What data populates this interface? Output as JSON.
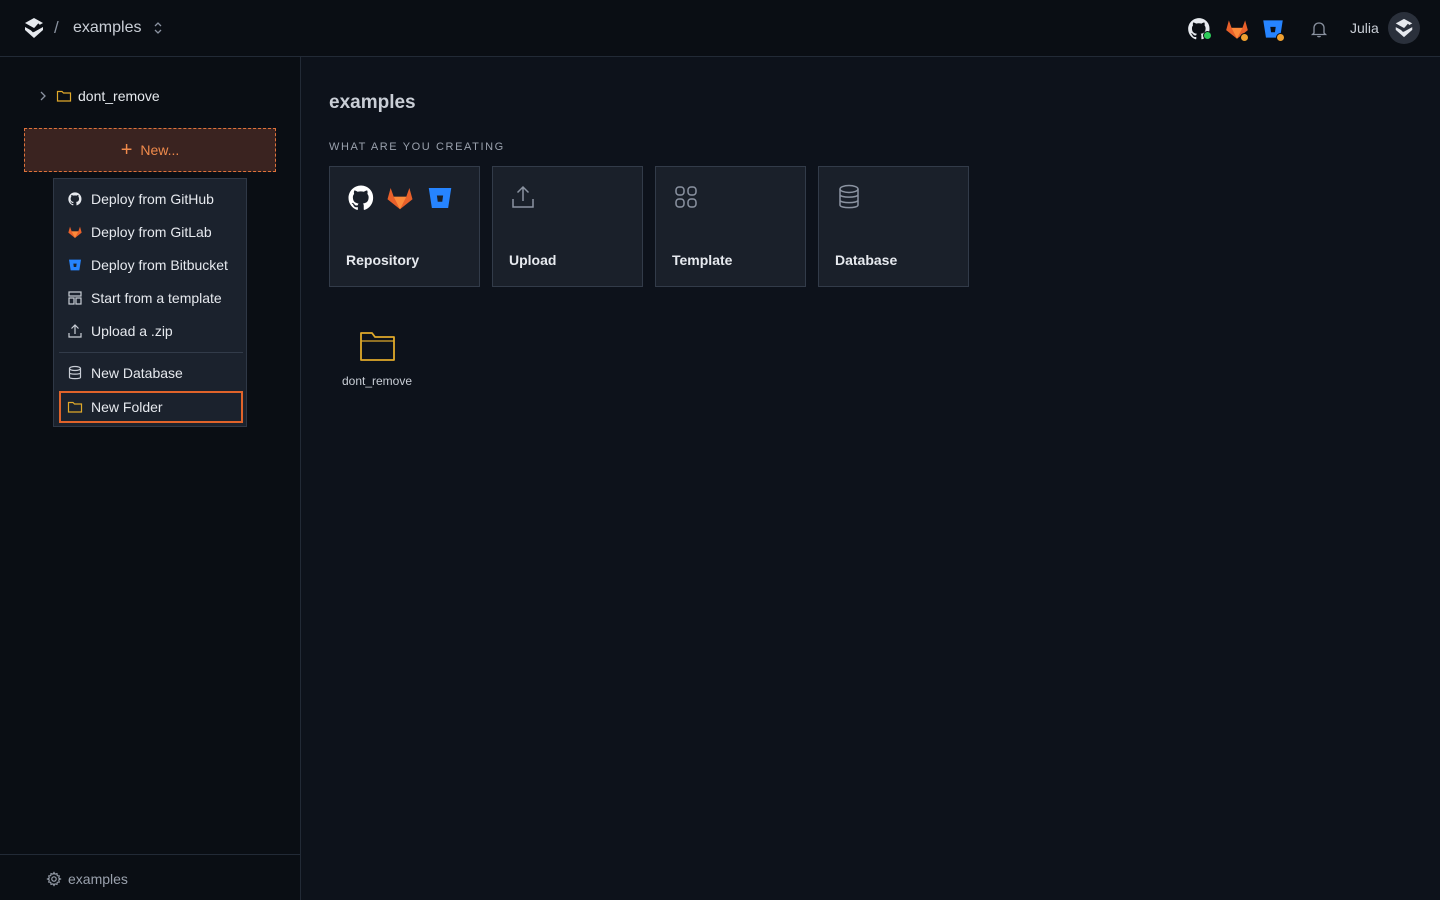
{
  "topbar": {
    "project_name": "examples",
    "separator": "/",
    "user_name": "Julia",
    "icons": [
      "logo-icon",
      "github-icon",
      "gitlab-icon",
      "bitbucket-icon",
      "bell-icon"
    ],
    "status_colors": {
      "github": "#2ecc5a",
      "gitlab": "#f0a030",
      "bitbucket": "#f0a030"
    }
  },
  "sidebar": {
    "tree": [
      {
        "label": "dont_remove"
      }
    ],
    "new_button": {
      "label": "New..."
    },
    "menu": {
      "items": [
        {
          "label": "Deploy from GitHub",
          "icon": "github-icon"
        },
        {
          "label": "Deploy from GitLab",
          "icon": "gitlab-icon"
        },
        {
          "label": "Deploy from Bitbucket",
          "icon": "bitbucket-icon"
        },
        {
          "label": "Start from a template",
          "icon": "template-icon"
        },
        {
          "label": "Upload a .zip",
          "icon": "upload-icon"
        },
        {
          "label": "New Database",
          "icon": "database-icon"
        },
        {
          "label": "New Folder",
          "icon": "folder-icon"
        }
      ],
      "selected": "New Folder"
    },
    "footer": {
      "label": "examples"
    }
  },
  "main": {
    "title": "examples",
    "section_label": "WHAT ARE YOU CREATING",
    "cards": [
      {
        "label": "Repository"
      },
      {
        "label": "Upload"
      },
      {
        "label": "Template"
      },
      {
        "label": "Database"
      }
    ],
    "folders": [
      {
        "label": "dont_remove"
      }
    ]
  },
  "colors": {
    "accent": "#e0733a",
    "folder": "#e0a92a",
    "gitlab": "#e8602a",
    "bitbucket": "#2684ff"
  }
}
